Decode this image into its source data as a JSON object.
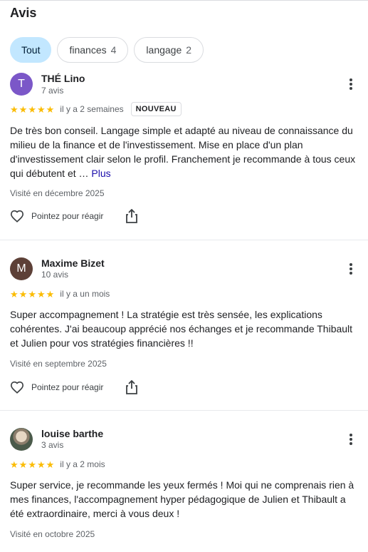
{
  "section": {
    "title": "Avis"
  },
  "filters": [
    {
      "label": "Tout",
      "count": ""
    },
    {
      "label": "finances",
      "count": "4"
    },
    {
      "label": "langage",
      "count": "2"
    }
  ],
  "colors": {
    "star": "#fbbc04",
    "chip_active": "#c2e7ff",
    "link": "#1a0dab"
  },
  "icons": {
    "more": "more-vert-icon",
    "heart": "heart-outline-icon",
    "share": "share-icon",
    "star": "star-icon"
  },
  "reviews": [
    {
      "initial": "T",
      "avatar_color": "#7b57c8",
      "name": "THÉ Lino",
      "review_count": "7 avis",
      "rating": 5,
      "date": "il y a 2 semaines",
      "badge": "NOUVEAU",
      "text": "De très bon conseil. Langage simple et adapté au niveau de connaissance du milieu de la finance et de l'investissement. Mise en place d'un plan d'investissement clair selon le profil. Franchement je recommande à tous ceux qui débutent et …",
      "more_label": "Plus",
      "visited": "Visité en décembre 2025",
      "react_label": "Pointez pour réagir"
    },
    {
      "initial": "M",
      "avatar_color": "#5d4037",
      "name": "Maxime Bizet",
      "review_count": "10 avis",
      "rating": 5,
      "date": "il y a un mois",
      "text": "Super accompagnement ! La stratégie est très sensée, les explications cohérentes. J'ai beaucoup apprécié nos échanges et je recommande Thibault et Julien pour vos stratégies financières !!",
      "visited": "Visité en septembre 2025",
      "react_label": "Pointez pour réagir"
    },
    {
      "name": "louise barthe",
      "review_count": "3 avis",
      "rating": 5,
      "date": "il y a 2 mois",
      "text": "Super service, je recommande les yeux fermés ! Moi qui ne comprenais rien à mes finances, l'accompagnement hyper pédagogique de Julien et Thibault a été extraordinaire, merci à vous deux !",
      "visited": "Visité en octobre 2025"
    }
  ]
}
